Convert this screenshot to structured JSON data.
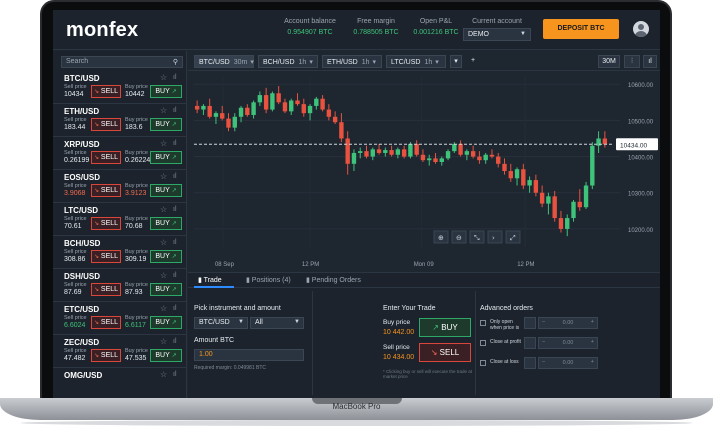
{
  "app": {
    "logo": "monfex",
    "device_label": "MacBook Pro"
  },
  "header": {
    "stats": [
      {
        "label": "Account balance",
        "value": "0.954907 BTC"
      },
      {
        "label": "Free margin",
        "value": "0.788505 BTC"
      },
      {
        "label": "Open P&L",
        "value": "0.001216 BTC"
      }
    ],
    "current_account_label": "Current account",
    "current_account_value": "DEMO",
    "deposit_label": "DEPOSIT BTC"
  },
  "sidebar": {
    "search_placeholder": "Search",
    "sell_price_label": "Sell price",
    "buy_price_label": "Buy price",
    "sell_label": "SELL",
    "buy_label": "BUY",
    "instruments": [
      {
        "name": "BTC/USD",
        "sell": "10434",
        "buy": "10442",
        "sell_color": "white",
        "buy_color": "white"
      },
      {
        "name": "ETH/USD",
        "sell": "183.44",
        "buy": "183.6",
        "sell_color": "white",
        "buy_color": "white"
      },
      {
        "name": "XRP/USD",
        "sell": "0.26199",
        "buy": "0.26224",
        "sell_color": "white",
        "buy_color": "white"
      },
      {
        "name": "EOS/USD",
        "sell": "3.9068",
        "buy": "3.9123",
        "sell_color": "red",
        "buy_color": "red"
      },
      {
        "name": "LTC/USD",
        "sell": "70.61",
        "buy": "70.68",
        "sell_color": "white",
        "buy_color": "white"
      },
      {
        "name": "BCH/USD",
        "sell": "308.86",
        "buy": "309.19",
        "sell_color": "white",
        "buy_color": "white"
      },
      {
        "name": "DSH/USD",
        "sell": "87.69",
        "buy": "87.93",
        "sell_color": "white",
        "buy_color": "white"
      },
      {
        "name": "ETC/USD",
        "sell": "6.6024",
        "buy": "6.6117",
        "sell_color": "green",
        "buy_color": "green"
      },
      {
        "name": "ZEC/USD",
        "sell": "47.482",
        "buy": "47.535",
        "sell_color": "white",
        "buy_color": "white"
      },
      {
        "name": "OMG/USD",
        "sell": "",
        "buy": "",
        "sell_color": "white",
        "buy_color": "white"
      }
    ]
  },
  "chart_toolbar": {
    "tabs": [
      {
        "symbol": "BTC/USD",
        "timeframe": "30m"
      },
      {
        "symbol": "BCH/USD",
        "timeframe": "1h"
      },
      {
        "symbol": "ETH/USD",
        "timeframe": "1h"
      },
      {
        "symbol": "LTC/USD",
        "timeframe": "1h"
      }
    ],
    "add_label": "+",
    "interval_label": "30M",
    "more_label": "▾"
  },
  "chart_data": {
    "type": "candlestick",
    "symbol": "BTC/USD",
    "timeframe": "30m",
    "x_ticks": [
      "08 Sep",
      "12 PM",
      "Mon 09",
      "12 PM"
    ],
    "y_ticks": [
      "10600.00",
      "10500.00",
      "10400.00",
      "10300.00",
      "10200.00"
    ],
    "ylim": [
      10150,
      10620
    ],
    "current_price": "10434.00",
    "current_price_value": 10434,
    "colors": {
      "up": "#3fc37b",
      "down": "#e8523f",
      "current_line": "#cfd6dd"
    },
    "candles": [
      [
        10540,
        10555,
        10520,
        10530
      ],
      [
        10530,
        10545,
        10515,
        10540
      ],
      [
        10540,
        10560,
        10505,
        10510
      ],
      [
        10510,
        10525,
        10490,
        10520
      ],
      [
        10520,
        10540,
        10500,
        10505
      ],
      [
        10505,
        10520,
        10470,
        10480
      ],
      [
        10480,
        10520,
        10470,
        10510
      ],
      [
        10510,
        10540,
        10495,
        10535
      ],
      [
        10535,
        10545,
        10510,
        10515
      ],
      [
        10515,
        10555,
        10505,
        10550
      ],
      [
        10550,
        10580,
        10540,
        10570
      ],
      [
        10570,
        10590,
        10520,
        10530
      ],
      [
        10530,
        10580,
        10525,
        10575
      ],
      [
        10575,
        10595,
        10545,
        10550
      ],
      [
        10550,
        10560,
        10520,
        10525
      ],
      [
        10525,
        10560,
        10515,
        10555
      ],
      [
        10555,
        10575,
        10540,
        10545
      ],
      [
        10545,
        10560,
        10510,
        10520
      ],
      [
        10520,
        10545,
        10500,
        10540
      ],
      [
        10540,
        10565,
        10530,
        10560
      ],
      [
        10560,
        10570,
        10525,
        10530
      ],
      [
        10530,
        10545,
        10500,
        10510
      ],
      [
        10510,
        10525,
        10490,
        10495
      ],
      [
        10495,
        10520,
        10440,
        10450
      ],
      [
        10450,
        10470,
        10350,
        10380
      ],
      [
        10380,
        10420,
        10360,
        10410
      ],
      [
        10410,
        10425,
        10395,
        10415
      ],
      [
        10415,
        10430,
        10395,
        10400
      ],
      [
        10400,
        10425,
        10390,
        10420
      ],
      [
        10420,
        10435,
        10405,
        10410
      ],
      [
        10410,
        10425,
        10400,
        10418
      ],
      [
        10418,
        10430,
        10400,
        10405
      ],
      [
        10405,
        10425,
        10395,
        10420
      ],
      [
        10420,
        10430,
        10395,
        10400
      ],
      [
        10400,
        10440,
        10395,
        10435
      ],
      [
        10435,
        10445,
        10400,
        10405
      ],
      [
        10405,
        10420,
        10385,
        10390
      ],
      [
        10390,
        10405,
        10375,
        10395
      ],
      [
        10395,
        10410,
        10380,
        10385
      ],
      [
        10385,
        10400,
        10375,
        10395
      ],
      [
        10395,
        10420,
        10390,
        10415
      ],
      [
        10415,
        10440,
        10410,
        10435
      ],
      [
        10435,
        10445,
        10400,
        10405
      ],
      [
        10405,
        10420,
        10390,
        10415
      ],
      [
        10415,
        10430,
        10395,
        10400
      ],
      [
        10400,
        10415,
        10380,
        10390
      ],
      [
        10390,
        10410,
        10380,
        10405
      ],
      [
        10405,
        10420,
        10395,
        10400
      ],
      [
        10400,
        10410,
        10370,
        10380
      ],
      [
        10380,
        10395,
        10350,
        10360
      ],
      [
        10360,
        10380,
        10330,
        10340
      ],
      [
        10340,
        10370,
        10320,
        10365
      ],
      [
        10365,
        10380,
        10310,
        10320
      ],
      [
        10320,
        10345,
        10300,
        10335
      ],
      [
        10335,
        10350,
        10290,
        10300
      ],
      [
        10300,
        10320,
        10260,
        10270
      ],
      [
        10270,
        10300,
        10240,
        10290
      ],
      [
        10290,
        10305,
        10220,
        10230
      ],
      [
        10230,
        10250,
        10190,
        10200
      ],
      [
        10200,
        10240,
        10180,
        10230
      ],
      [
        10230,
        10280,
        10220,
        10275
      ],
      [
        10275,
        10310,
        10250,
        10260
      ],
      [
        10260,
        10330,
        10255,
        10320
      ],
      [
        10320,
        10440,
        10310,
        10430
      ],
      [
        10430,
        10470,
        10410,
        10450
      ],
      [
        10450,
        10470,
        10425,
        10434
      ]
    ]
  },
  "panel": {
    "tabs": [
      "Trade",
      "Positions (4)",
      "Pending Orders"
    ],
    "pick_label": "Pick instrument and amount",
    "instrument_value": "BTC/USD",
    "filter_value": "All",
    "amount_label": "Amount BTC",
    "amount_value": "1.00",
    "required_margin": "Required margin: 0.049981 BTC",
    "enter_trade_label": "Enter Your Trade",
    "buy_price_label": "Buy price",
    "buy_price_value": "10 442.00",
    "sell_price_label": "Sell price",
    "sell_price_value": "10 434.00",
    "buy_label": "BUY",
    "sell_label": "SELL",
    "disclaimer": "* Clicking buy or sell will execute the trade at market price",
    "advanced_label": "Advanced orders",
    "advanced_rows": [
      {
        "label": "Only open when price is",
        "value": "0.00"
      },
      {
        "label": "Close at profit",
        "value": "0.00"
      },
      {
        "label": "Close at loss",
        "value": "0.00"
      }
    ]
  }
}
